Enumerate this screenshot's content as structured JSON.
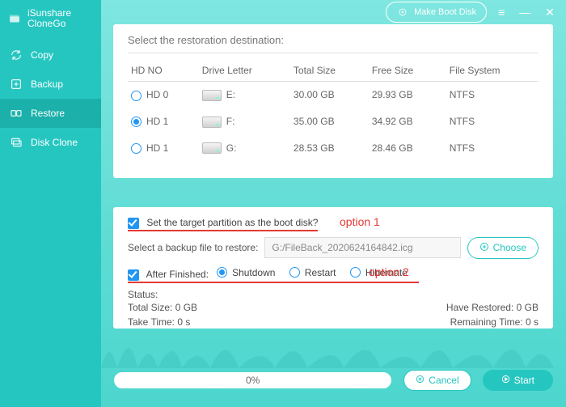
{
  "brand": {
    "line1": "iSunshare",
    "line2": "CloneGo"
  },
  "titlebar": {
    "make_boot_label": "Make Boot Disk"
  },
  "sidebar": {
    "items": [
      {
        "key": "copy",
        "label": "Copy"
      },
      {
        "key": "backup",
        "label": "Backup"
      },
      {
        "key": "restore",
        "label": "Restore",
        "active": true
      },
      {
        "key": "diskclone",
        "label": "Disk Clone"
      }
    ]
  },
  "panel": {
    "heading": "Select the restoration destination:",
    "columns": [
      "HD NO",
      "Drive Letter",
      "Total Size",
      "Free Size",
      "File System"
    ],
    "rows": [
      {
        "hd": "HD 0",
        "letter": "E:",
        "total": "30.00 GB",
        "free": "29.93 GB",
        "fs": "NTFS",
        "selected": false
      },
      {
        "hd": "HD 1",
        "letter": "F:",
        "total": "35.00 GB",
        "free": "34.92 GB",
        "fs": "NTFS",
        "selected": true
      },
      {
        "hd": "HD 1",
        "letter": "G:",
        "total": "28.53 GB",
        "free": "28.46 GB",
        "fs": "NTFS",
        "selected": false
      }
    ]
  },
  "options": {
    "set_boot_label": "Set the target partition as the boot disk?",
    "anno1": "option 1",
    "select_backup_label": "Select a backup file to restore:",
    "backup_file_value": "G:/FileBack_2020624164842.icg",
    "choose_label": "Choose",
    "after_finished_label": "After Finished:",
    "anno2": "option 2",
    "after_options": [
      {
        "label": "Shutdown",
        "selected": true
      },
      {
        "label": "Restart",
        "selected": false
      },
      {
        "label": "Hibernate",
        "selected": false
      }
    ],
    "status_heading": "Status:",
    "status": {
      "total_size_label": "Total Size:",
      "total_size_value": "0 GB",
      "restored_label": "Have Restored:",
      "restored_value": "0 GB",
      "take_time_label": "Take Time:",
      "take_time_value": "0 s",
      "remaining_label": "Remaining Time:",
      "remaining_value": "0 s"
    }
  },
  "bottom": {
    "progress_text": "0%",
    "cancel_label": "Cancel",
    "start_label": "Start"
  }
}
